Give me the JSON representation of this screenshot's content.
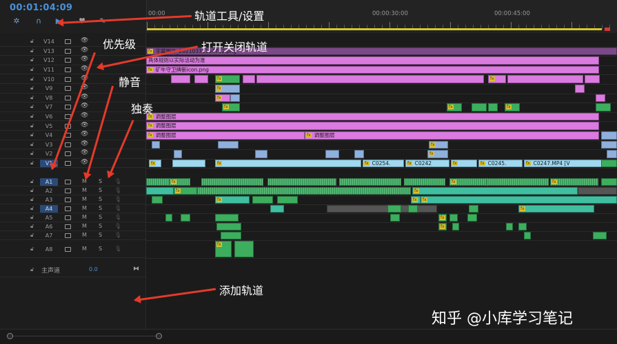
{
  "header": {
    "timecode": "00:01:04:09",
    "tools": [
      "snap-icon",
      "magnet-icon",
      "linked-select-icon",
      "marker-icon",
      "wrench-icon"
    ]
  },
  "ruler": {
    "labels": [
      "00:00",
      "00:00:30:00",
      "00:00:45:00"
    ]
  },
  "tracks": {
    "video": [
      "V14",
      "V13",
      "V12",
      "V11",
      "V10",
      "V9",
      "V8",
      "V7",
      "V6",
      "V5",
      "V4",
      "V3",
      "V2",
      "V1"
    ],
    "audio": [
      "A1",
      "A2",
      "A3",
      "A4",
      "A5",
      "A6",
      "A7",
      "A8"
    ],
    "mute_label": "M",
    "solo_label": "S",
    "selected": [
      "V1",
      "A1",
      "A4"
    ],
    "master_label": "主声道",
    "master_value": "0.0"
  },
  "clips": {
    "v13": "字幕图片_20210331154712.png",
    "v12": "具体规则以实际活动为准",
    "v11": "矿牛守卫牌新icon.png",
    "v6": "调整图层",
    "v5": "调整图层",
    "v4a": "调整图层",
    "v4b": "调整图层",
    "v1a": "C0254.",
    "v1b": "C0242",
    "v1c": "C0245.",
    "v1d": "C0247.MP4 [V"
  },
  "annotations": {
    "track_tools": "轨道工具/设置",
    "toggle_track": "打开关闭轨道",
    "priority": "优先级",
    "mute": "静音",
    "solo": "独奏",
    "add_track": "添加轨道"
  },
  "watermark": "知乎 @小库学习笔记",
  "colors": {
    "timecode": "#4a90d9",
    "arrow": "#e53a2a",
    "pink_clip": "#db7ae0",
    "green_clip": "#3cae5e",
    "cyan_clip": "#9fd8f0"
  }
}
